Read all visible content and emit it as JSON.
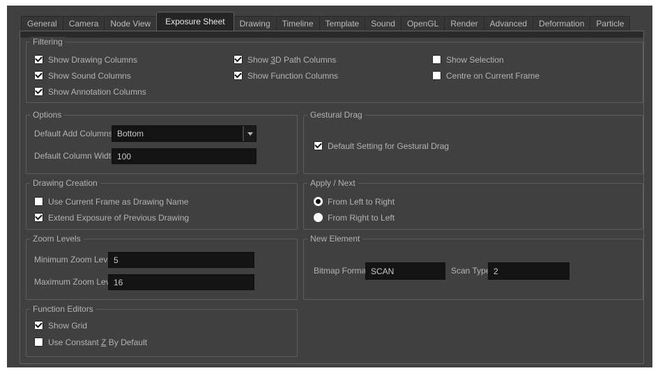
{
  "colors": {
    "page_bg": "#ffffff",
    "dialog_bg": "#404040",
    "field_bg": "#141414",
    "label_text": "#b3b3b3",
    "field_text": "#c9c9c9",
    "active_tab_bg": "#252525",
    "checkbox_fill": "#ffffff"
  },
  "tabs": {
    "active": "Exposure Sheet",
    "items": [
      "General",
      "Camera",
      "Node View",
      "Exposure Sheet",
      "Drawing",
      "Timeline",
      "Template",
      "Sound",
      "OpenGL",
      "Render",
      "Advanced",
      "Deformation",
      "Particle"
    ]
  },
  "filtering": {
    "title": "Filtering",
    "col1": [
      {
        "label": "Show Drawing Columns",
        "checked": true
      },
      {
        "label": "Show Sound Columns",
        "checked": true
      },
      {
        "label": "Show Annotation Columns",
        "checked": true
      }
    ],
    "col2": [
      {
        "label_html": "Show <u>3</u>D Path Columns",
        "checked": true
      },
      {
        "label": "Show Function Columns",
        "checked": true
      }
    ],
    "col3": [
      {
        "label": "Show Selection",
        "checked": false
      },
      {
        "label": "Centre on Current Frame",
        "checked": false
      }
    ]
  },
  "options": {
    "title": "Options",
    "default_add_columns": {
      "label": "Default Add Columns",
      "value": "Bottom"
    },
    "default_column_width": {
      "label": "Default Column Width",
      "value": "100"
    }
  },
  "gestural_drag": {
    "title": "Gestural Drag",
    "checkbox": {
      "label": "Default Setting for Gestural Drag",
      "checked": true
    }
  },
  "drawing_creation": {
    "title": "Drawing Creation",
    "checkboxes": [
      {
        "label": "Use Current Frame as Drawing Name",
        "checked": false
      },
      {
        "label": "Extend Exposure of Previous Drawing",
        "checked": true
      }
    ]
  },
  "apply_next": {
    "title": "Apply / Next",
    "radios": [
      {
        "label": "From Left to Right",
        "selected": true
      },
      {
        "label": "From Right to Left",
        "selected": false
      }
    ]
  },
  "zoom_levels": {
    "title": "Zoom Levels",
    "minimum": {
      "label": "Minimum Zoom Level",
      "value": "5"
    },
    "maximum": {
      "label": "Maximum Zoom Level",
      "value": "16"
    }
  },
  "new_element": {
    "title": "New Element",
    "bitmap_format": {
      "label": "Bitmap Format",
      "value": "SCAN"
    },
    "scan_type": {
      "label": "Scan Type",
      "value": "2"
    }
  },
  "function_editors": {
    "title": "Function Editors",
    "checkboxes": [
      {
        "label": "Show Grid",
        "checked": true
      },
      {
        "label_html": "Use Constant <u>Z</u> By Default",
        "checked": false
      }
    ]
  }
}
